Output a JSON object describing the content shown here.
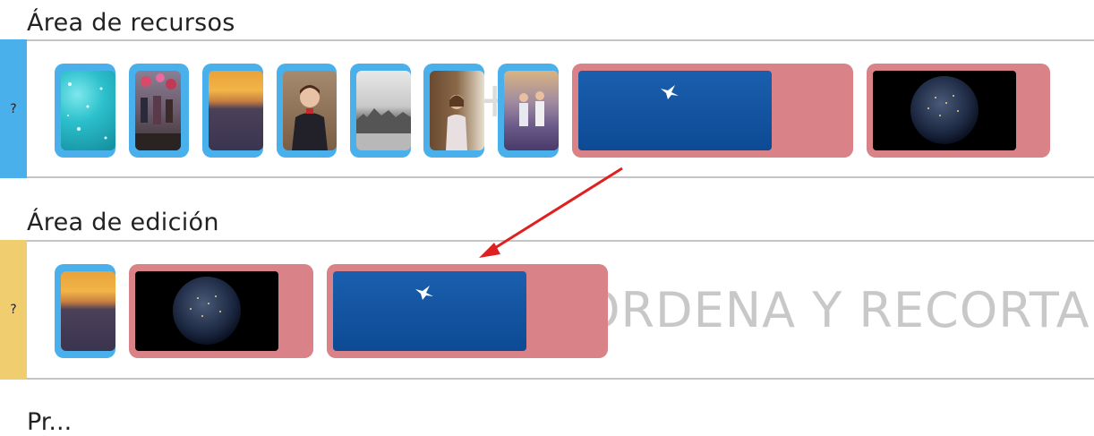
{
  "resources": {
    "title": "Área de recursos",
    "handle_label": "?",
    "watermark": "+ I"
  },
  "editing": {
    "title": "Área de edición",
    "handle_label": "?",
    "watermark": "ORDENA Y RECORTA"
  },
  "bottom": {
    "title": "Pr..."
  },
  "colors": {
    "image_clip": "#4ab0ec",
    "video_clip": "#d98287",
    "resources_handle": "#4ab0ec",
    "editing_handle": "#f0cd6f",
    "arrow": "#e02020"
  },
  "resource_clips": [
    {
      "kind": "image",
      "subject": "turquoise water sparkles"
    },
    {
      "kind": "image",
      "subject": "people with balloons"
    },
    {
      "kind": "image",
      "subject": "sunset over lavender field"
    },
    {
      "kind": "image",
      "subject": "boy portrait"
    },
    {
      "kind": "image",
      "subject": "snowy landscape"
    },
    {
      "kind": "image",
      "subject": "girl in room"
    },
    {
      "kind": "image",
      "subject": "kids in lavender field"
    },
    {
      "kind": "video",
      "subject": "bird flying in blue sky"
    },
    {
      "kind": "video",
      "subject": "earth at night"
    }
  ],
  "edit_clips": [
    {
      "kind": "image",
      "subject": "sunset over lavender field"
    },
    {
      "kind": "video",
      "subject": "earth at night"
    },
    {
      "kind": "video",
      "subject": "bird flying in blue sky"
    }
  ]
}
